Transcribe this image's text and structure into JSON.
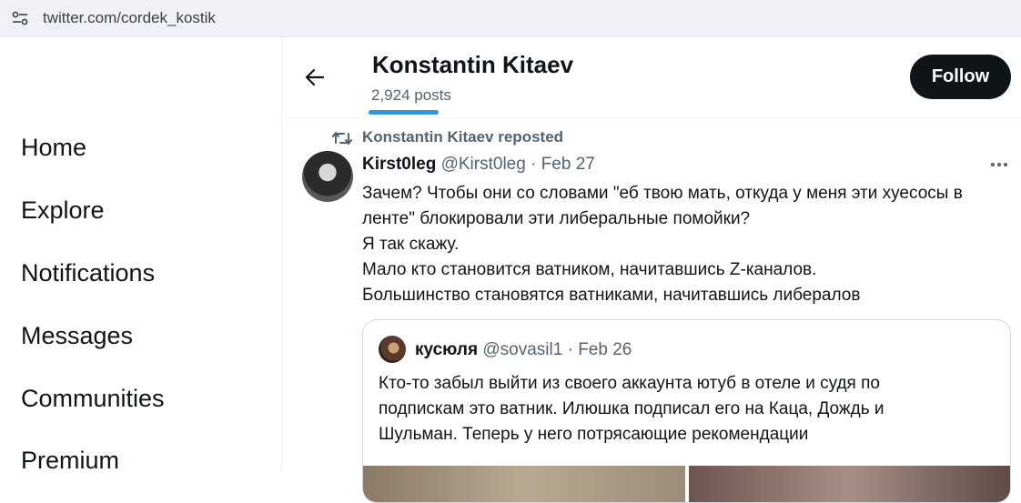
{
  "browser": {
    "url": "twitter.com/cordek_kostik"
  },
  "nav": {
    "items": [
      {
        "label": "Home"
      },
      {
        "label": "Explore"
      },
      {
        "label": "Notifications"
      },
      {
        "label": "Messages"
      },
      {
        "label": "Communities"
      },
      {
        "label": "Premium"
      }
    ]
  },
  "header": {
    "name": "Konstantin Kitaev",
    "posts": "2,924 posts",
    "follow_label": "Follow"
  },
  "repost": {
    "text": "Konstantin Kitaev reposted"
  },
  "tweet": {
    "author": "Kirst0leg",
    "handle": "@Kirst0leg",
    "separator": "·",
    "date": "Feb 27",
    "lines": [
      "Зачем? Чтобы они со словами \"еб твою мать, откуда у меня эти хуесосы в",
      "ленте\" блокировали эти либеральные помойки?",
      "Я так скажу.",
      "Мало кто становится ватником, начитавшись Z-каналов.",
      "Большинство становятся ватниками, начитавшись либералов"
    ]
  },
  "quote": {
    "author": "кусюля",
    "handle": "@sovasil1",
    "separator": "·",
    "date": "Feb 26",
    "lines": [
      "Кто-то забыл выйти из своего аккаунта ютуб в отеле и судя по",
      "подпискам это ватник. Илюшка подписал его на Каца, Дождь и",
      "Шульман. Теперь у него потрясающие рекомендации"
    ]
  },
  "icons": {
    "site_info": "site-settings-icon",
    "back": "back-arrow-icon",
    "repost": "repost-icon",
    "more": "more-icon"
  },
  "colors": {
    "accent": "#1d9bf0",
    "text": "#0f1419",
    "secondary": "#536471"
  }
}
